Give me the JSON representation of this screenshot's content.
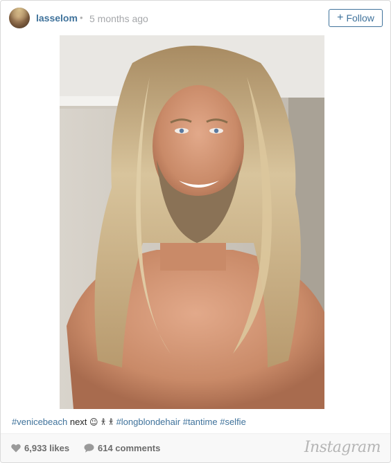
{
  "post": {
    "username": "lasselom",
    "separator": "•",
    "timestamp": "5 months ago",
    "follow_plus": "+",
    "follow_label": "Follow"
  },
  "media": {
    "image_description": "selfie",
    "user_tag_icon": "person-tag-icon"
  },
  "caption": {
    "tag1": "#venicebeach",
    "text1": " next ",
    "emoji": "☺ 𐀪 𐀪 ",
    "tag2": "#longblondehair",
    "tag3": "#tantime",
    "tag4": "#selfie"
  },
  "footer": {
    "likes": "6,933 likes",
    "comments": "614 comments",
    "brand": "Instagram"
  },
  "colors": {
    "link": "#3f729b",
    "meta": "#a5a7aa",
    "footer_bg": "#f8f8f8"
  }
}
